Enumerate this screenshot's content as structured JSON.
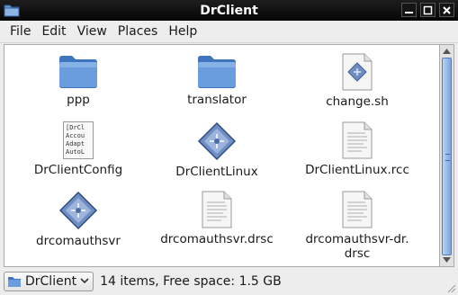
{
  "window": {
    "title": "DrClient",
    "icon": "folder-icon",
    "controls": [
      "minimize-icon",
      "maximize-icon",
      "close-icon"
    ]
  },
  "menubar": {
    "items": [
      "File",
      "Edit",
      "View",
      "Places",
      "Help"
    ]
  },
  "files": [
    {
      "name": "ppp",
      "type": "folder"
    },
    {
      "name": "translator",
      "type": "folder"
    },
    {
      "name": "change.sh",
      "type": "script"
    },
    {
      "name": "DrClientConfig",
      "type": "text-preview",
      "preview": [
        "[DrCl",
        "Accou",
        "Adapt",
        "AutoL"
      ]
    },
    {
      "name": "DrClientLinux",
      "type": "executable"
    },
    {
      "name": "DrClientLinux.rcc",
      "type": "document"
    },
    {
      "name": "drcomauthsvr",
      "type": "executable"
    },
    {
      "name": "drcomauthsvr.drsc",
      "type": "document"
    },
    {
      "name": "drcomauthsvr-dr.\ndrsc",
      "type": "document"
    }
  ],
  "statusbar": {
    "location": "DrClient",
    "summary": "14 items, Free space: 1.5 GB"
  },
  "colors": {
    "titlebar": "#0f0f0f",
    "folder_blue": "#5b8fd4",
    "scroll_thumb": "#7aa6dc"
  }
}
